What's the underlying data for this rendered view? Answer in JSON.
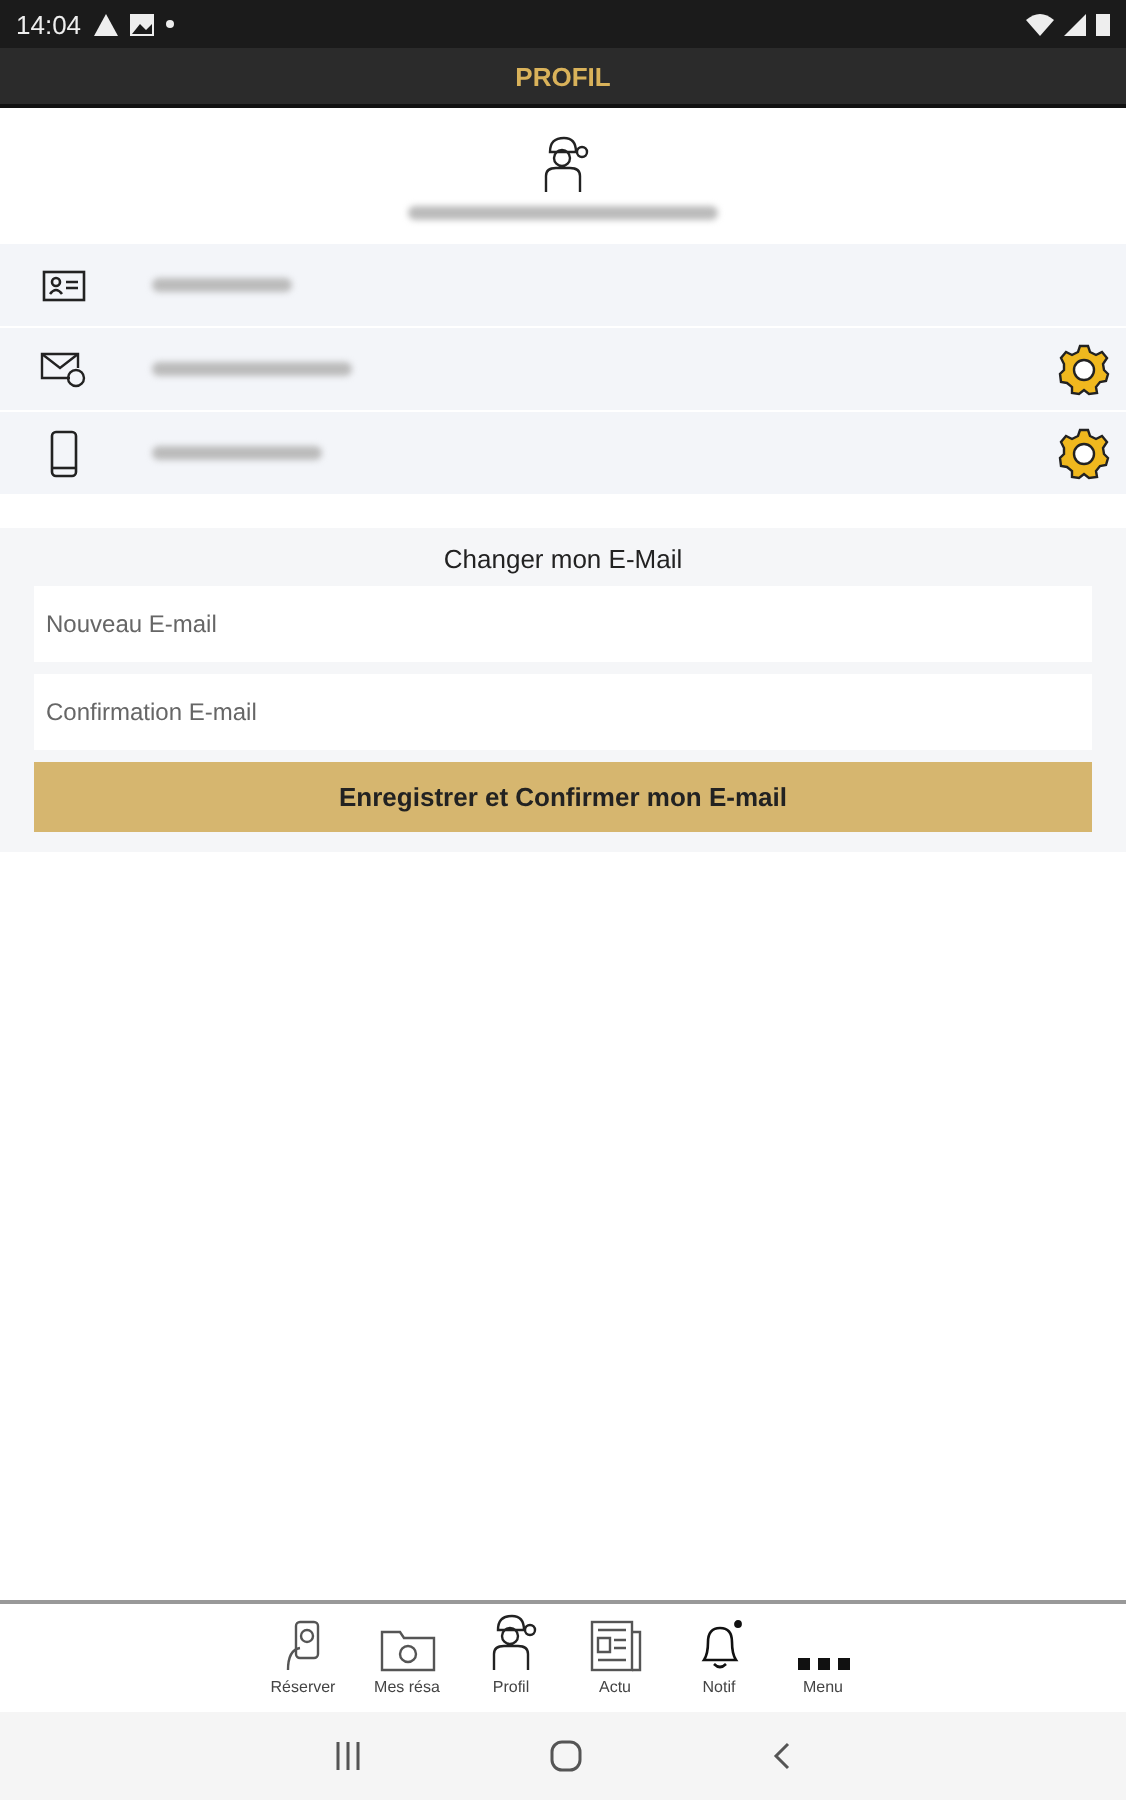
{
  "status_bar": {
    "time": "14:04"
  },
  "header": {
    "title": "PROFIL"
  },
  "info_rows": [
    {
      "kind": "id",
      "editable": false
    },
    {
      "kind": "email",
      "editable": true
    },
    {
      "kind": "phone",
      "editable": true
    }
  ],
  "email_form": {
    "title": "Changer mon E-Mail",
    "fields": [
      {
        "placeholder": "Nouveau E-mail"
      },
      {
        "placeholder": "Confirmation E-mail"
      }
    ],
    "submit": "Enregistrer et Confirmer mon E-mail"
  },
  "bottom_nav": [
    {
      "kind": "book",
      "label": "Réserver"
    },
    {
      "kind": "folder",
      "label": "Mes résa"
    },
    {
      "kind": "person",
      "label": "Profil"
    },
    {
      "kind": "news",
      "label": "Actu"
    },
    {
      "kind": "bell",
      "label": "Notif"
    },
    {
      "kind": "dots",
      "label": "Menu"
    }
  ]
}
